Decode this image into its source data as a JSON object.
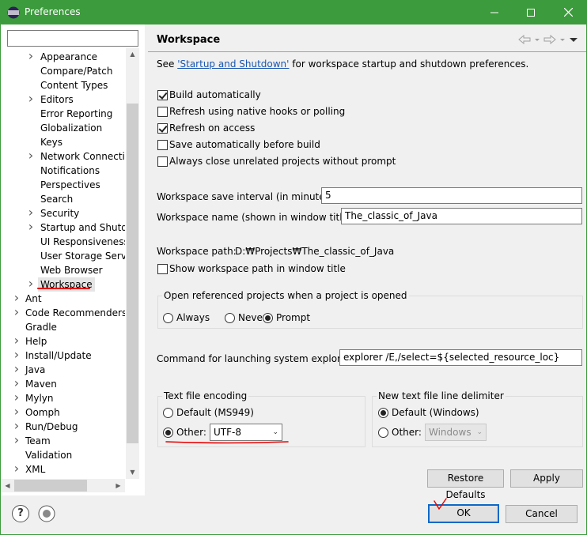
{
  "window": {
    "title": "Preferences"
  },
  "tree": {
    "filter_value": "",
    "items": [
      {
        "label": "Appearance",
        "expandable": true
      },
      {
        "label": "Compare/Patch",
        "expandable": false
      },
      {
        "label": "Content Types",
        "expandable": false
      },
      {
        "label": "Editors",
        "expandable": true
      },
      {
        "label": "Error Reporting",
        "expandable": false
      },
      {
        "label": "Globalization",
        "expandable": false
      },
      {
        "label": "Keys",
        "expandable": false
      },
      {
        "label": "Network Connection",
        "expandable": true
      },
      {
        "label": "Notifications",
        "expandable": false
      },
      {
        "label": "Perspectives",
        "expandable": false
      },
      {
        "label": "Search",
        "expandable": false
      },
      {
        "label": "Security",
        "expandable": true
      },
      {
        "label": "Startup and Shutdo",
        "expandable": true
      },
      {
        "label": "UI Responsiveness M",
        "expandable": false
      },
      {
        "label": "User Storage Service",
        "expandable": false
      },
      {
        "label": "Web Browser",
        "expandable": false
      },
      {
        "label": "Workspace",
        "expandable": true,
        "selected": true
      },
      {
        "label": "Ant",
        "expandable": true
      },
      {
        "label": "Code Recommenders",
        "expandable": true
      },
      {
        "label": "Gradle",
        "expandable": false
      },
      {
        "label": "Help",
        "expandable": true
      },
      {
        "label": "Install/Update",
        "expandable": true
      },
      {
        "label": "Java",
        "expandable": true
      },
      {
        "label": "Maven",
        "expandable": true
      },
      {
        "label": "Mylyn",
        "expandable": true
      },
      {
        "label": "Oomph",
        "expandable": true
      },
      {
        "label": "Run/Debug",
        "expandable": true
      },
      {
        "label": "Team",
        "expandable": true
      },
      {
        "label": "Validation",
        "expandable": false
      },
      {
        "label": "XML",
        "expandable": true
      }
    ]
  },
  "page": {
    "title": "Workspace",
    "see_prefix": "See ",
    "see_link": "'Startup and Shutdown'",
    "see_suffix": " for workspace startup and shutdown preferences.",
    "checkboxes": [
      {
        "label": "Build automatically",
        "checked": true
      },
      {
        "label": "Refresh using native hooks or polling",
        "checked": false
      },
      {
        "label": "Refresh on access",
        "checked": true
      },
      {
        "label": "Save automatically before build",
        "checked": false
      },
      {
        "label": "Always close unrelated projects without prompt",
        "checked": false
      }
    ],
    "save_interval_label": "Workspace save interval (in minutes):",
    "save_interval_value": "5",
    "workspace_name_label": "Workspace name (shown in window title):",
    "workspace_name_value": "The_classic_of_Java",
    "workspace_path_label": "Workspace path:",
    "workspace_path_value": "D:₩Projects₩The_classic_of_Java",
    "show_path_label": "Show workspace path in window title",
    "show_path_checked": false,
    "open_projects": {
      "label": "Open referenced projects when a project is opened",
      "options": [
        "Always",
        "Never",
        "Prompt"
      ],
      "selected": "Prompt"
    },
    "explorer_label": "Command for launching system explorer:",
    "explorer_value": "explorer /E,/select=${selected_resource_loc}",
    "encoding": {
      "label": "Text file encoding",
      "default_option": "Default (MS949)",
      "other_option": "Other:",
      "selected": "Other",
      "other_value": "UTF-8"
    },
    "line_delimiter": {
      "label": "New text file line delimiter",
      "default_option": "Default (Windows)",
      "other_option": "Other:",
      "selected": "Default",
      "other_value": "Windows"
    },
    "restore_defaults_label": "Restore Defaults",
    "apply_label": "Apply"
  },
  "dialog": {
    "ok_label": "OK",
    "cancel_label": "Cancel"
  },
  "colors": {
    "titlebar": "#3c9b3c",
    "annotation_red": "#e60000",
    "link_blue": "#1a56b0",
    "default_button_border": "#0a68c7"
  }
}
